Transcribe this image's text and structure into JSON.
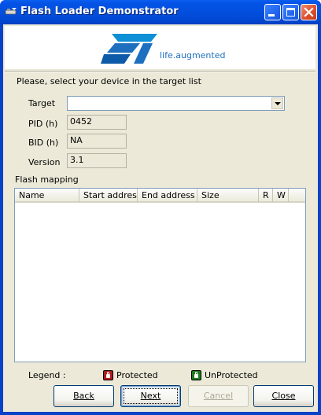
{
  "window": {
    "title": "Flash Loader Demonstrator"
  },
  "banner": {
    "logo_text": "ST",
    "tagline": "life.augmented"
  },
  "form": {
    "instruction": "Please, select your device in the target list",
    "target_label": "Target",
    "target_value": "",
    "pid_label": "PID  (h)",
    "pid_value": "0452",
    "bid_label": "BID  (h)",
    "bid_value": "NA",
    "version_label": "Version",
    "version_value": "3.1"
  },
  "flash_mapping": {
    "label": "Flash mapping",
    "columns": [
      "Name",
      "Start address",
      "End address",
      "Size",
      "R",
      "W"
    ],
    "rows": []
  },
  "legend": {
    "label": "Legend :",
    "protected_label": "Protected",
    "unprotected_label": "UnProtected",
    "protected_color": "#b01b1b",
    "unprotected_color": "#1e7a1e"
  },
  "buttons": {
    "back": "Back",
    "next": "Next",
    "cancel": "Cancel",
    "close": "Close"
  },
  "colors": {
    "title_bar": "#0453e6",
    "dialog_bg": "#ece9d8",
    "st_blue": "#1e6fbf"
  }
}
